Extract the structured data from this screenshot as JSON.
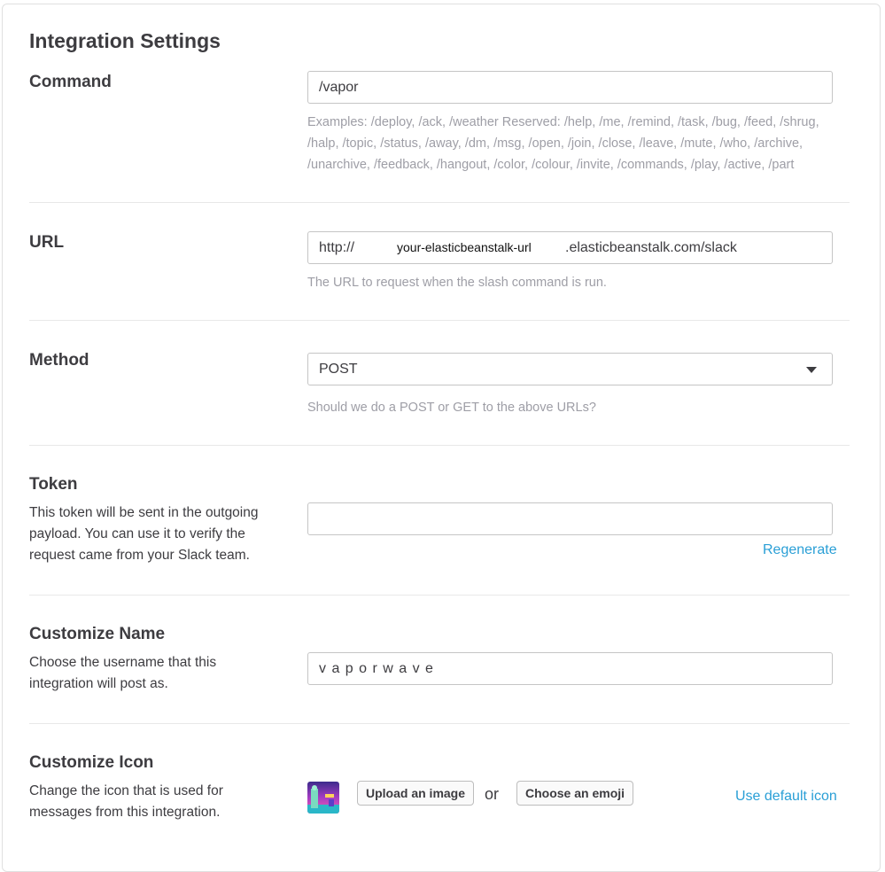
{
  "page": {
    "title": "Integration Settings"
  },
  "command": {
    "label": "Command",
    "value": "/vapor",
    "help": "Examples: /deploy, /ack, /weather Reserved: /help, /me, /remind, /task, /bug, /feed, /shrug, /halp, /topic, /status, /away, /dm, /msg, /open, /join, /close, /leave, /mute, /who, /archive, /unarchive, /feedback, /hangout, /color, /colour, /invite, /commands, /play, /active, /part"
  },
  "url": {
    "label": "URL",
    "prefix": "http://",
    "middle": "your-elasticbeanstalk-url",
    "suffix": ".elasticbeanstalk.com/slack",
    "help": "The URL to request when the slash command is run."
  },
  "method": {
    "label": "Method",
    "selected": "POST",
    "help": "Should we do a POST or GET to the above URLs?"
  },
  "token": {
    "label": "Token",
    "description": "This token will be sent in the outgoing payload. You can use it to verify the request came from your Slack team.",
    "value": "",
    "regenerate_label": "Regenerate"
  },
  "name": {
    "label": "Customize Name",
    "description": "Choose the username that this integration will post as.",
    "value": "v a p o r w a v e"
  },
  "icon": {
    "label": "Customize Icon",
    "description": "Change the icon that is used for messages from this integration.",
    "upload_label": "Upload an image",
    "or_label": "or",
    "emoji_label": "Choose an emoji",
    "default_label": "Use default icon",
    "avatar_icon": "vaporwave-avatar-image"
  }
}
